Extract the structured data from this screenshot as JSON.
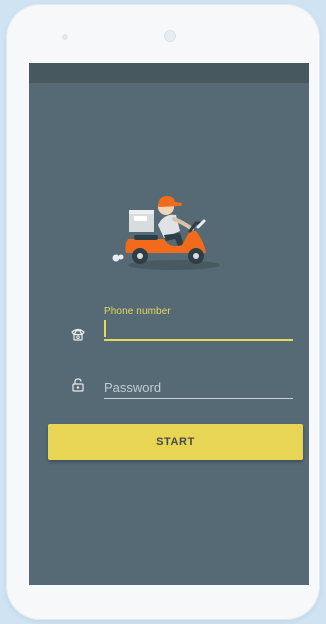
{
  "app": {
    "hero_image": "delivery-scooter-rider-illustration"
  },
  "form": {
    "phone": {
      "label": "Phone number",
      "value": "",
      "icon": "phone-icon"
    },
    "password": {
      "placeholder": "Password",
      "value": "",
      "icon": "unlock-icon"
    },
    "start_label": "START"
  },
  "colors": {
    "screen_background": "#556a74",
    "status_bar": "#48585f",
    "accent": "#e7d553",
    "scooter": "#f26a1b"
  }
}
